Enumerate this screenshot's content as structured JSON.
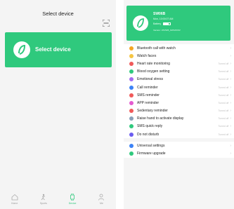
{
  "left": {
    "title": "Select device",
    "card_label": "Select device",
    "colors": {
      "accent": "#2fc97d",
      "background": "#f4f4f4"
    },
    "tabs": [
      {
        "label": "Home",
        "icon": "home-icon",
        "active": false
      },
      {
        "label": "Sports",
        "icon": "sports-icon",
        "active": false
      },
      {
        "label": "Device",
        "icon": "watch-icon",
        "active": true
      },
      {
        "label": "Me",
        "icon": "person-icon",
        "active": false
      }
    ]
  },
  "right": {
    "device": {
      "name": "SW06B",
      "time": "Mon, 10:00:07 AM",
      "battery_label": "Battery",
      "battery_level": 0.75,
      "version": "Version: V0V525_0V0V0V0V"
    },
    "settings": [
      {
        "label": "Bluetooth call with watch",
        "value": "",
        "icon": "phone-icon",
        "color": "#f5a623"
      },
      {
        "label": "Watch faces",
        "value": "",
        "icon": "watch-face-icon",
        "color": "#f5c542"
      },
      {
        "label": "Heart rate monitoring",
        "value": "Turned off",
        "icon": "heart-icon",
        "color": "#f05a5a"
      },
      {
        "label": "Blood oxygen setting",
        "value": "Turned off",
        "icon": "drop-icon",
        "color": "#2fc97d"
      },
      {
        "label": "Emotional stress",
        "value": "Turned off",
        "icon": "emotion-icon",
        "color": "#a56cf0"
      },
      {
        "label": "Call reminder",
        "value": "Turned off",
        "icon": "call-icon",
        "color": "#3b82f6"
      },
      {
        "label": "SMS reminder",
        "value": "Turned off",
        "icon": "sms-icon",
        "color": "#f05a5a"
      },
      {
        "label": "APP reminder",
        "value": "Turned off",
        "icon": "app-icon",
        "color": "#e45bd0"
      },
      {
        "label": "Sedentary reminder",
        "value": "Turned off",
        "icon": "chair-icon",
        "color": "#f05a5a"
      },
      {
        "label": "Raise hand to activate display",
        "value": "Turned off",
        "icon": "hand-icon",
        "color": "#8aa0b8"
      },
      {
        "label": "SMS quick reply",
        "value": "Turned off",
        "icon": "reply-icon",
        "color": "#2fc97d"
      },
      {
        "label": "Do not disturb",
        "value": "Turned off",
        "icon": "moon-icon",
        "color": "#6b5cf0"
      }
    ],
    "more": [
      {
        "label": "Universal settings",
        "value": "",
        "icon": "settings-icon",
        "color": "#3b82f6"
      },
      {
        "label": "Firmware upgrade",
        "value": "",
        "icon": "upgrade-icon",
        "color": "#2fc97d"
      }
    ]
  }
}
